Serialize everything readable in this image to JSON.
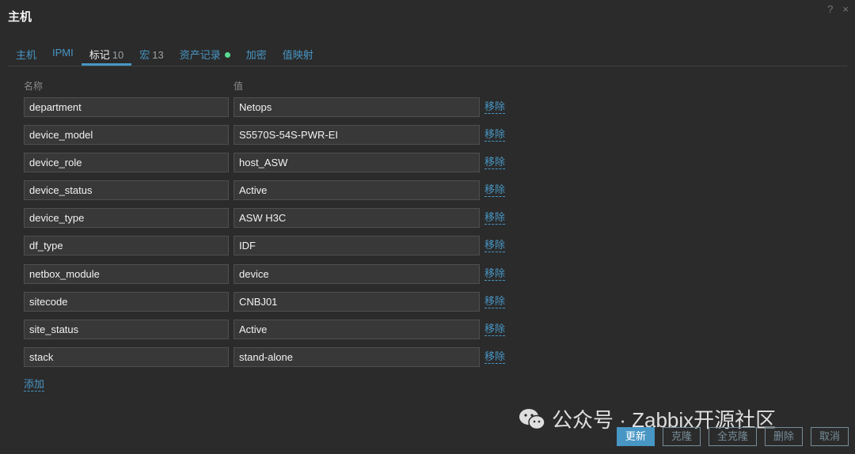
{
  "dialog": {
    "title": "主机",
    "help_icon": "?",
    "close_icon": "×"
  },
  "tabs": [
    {
      "label": "主机",
      "count": "",
      "active": false
    },
    {
      "label": "IPMI",
      "count": "",
      "active": false
    },
    {
      "label": "标记",
      "count": "10",
      "active": true
    },
    {
      "label": "宏",
      "count": "13",
      "active": false
    },
    {
      "label": "资产记录",
      "count": "",
      "active": false,
      "status_dot_color": "#59db8f"
    },
    {
      "label": "加密",
      "count": "",
      "active": false
    },
    {
      "label": "值映射",
      "count": "",
      "active": false
    }
  ],
  "table": {
    "name_header": "名称",
    "value_header": "值",
    "remove_label": "移除",
    "rows": [
      {
        "name": "department",
        "value": "Netops"
      },
      {
        "name": "device_model",
        "value": "S5570S-54S-PWR-EI"
      },
      {
        "name": "device_role",
        "value": "host_ASW"
      },
      {
        "name": "device_status",
        "value": "Active"
      },
      {
        "name": "device_type",
        "value": "ASW H3C"
      },
      {
        "name": "df_type",
        "value": "IDF"
      },
      {
        "name": "netbox_module",
        "value": "device"
      },
      {
        "name": "sitecode",
        "value": "CNBJ01"
      },
      {
        "name": "site_status",
        "value": "Active"
      },
      {
        "name": "stack",
        "value": "stand-alone"
      }
    ],
    "add_label": "添加"
  },
  "watermark": {
    "text": "公众号 · Zabbix开源社区"
  },
  "footer": {
    "update": "更新",
    "clone": "克隆",
    "full_clone": "全克隆",
    "delete": "删除",
    "cancel": "取消"
  },
  "colors": {
    "background": "#2b2b2b",
    "accent": "#4796c4",
    "status_green": "#59db8f"
  }
}
